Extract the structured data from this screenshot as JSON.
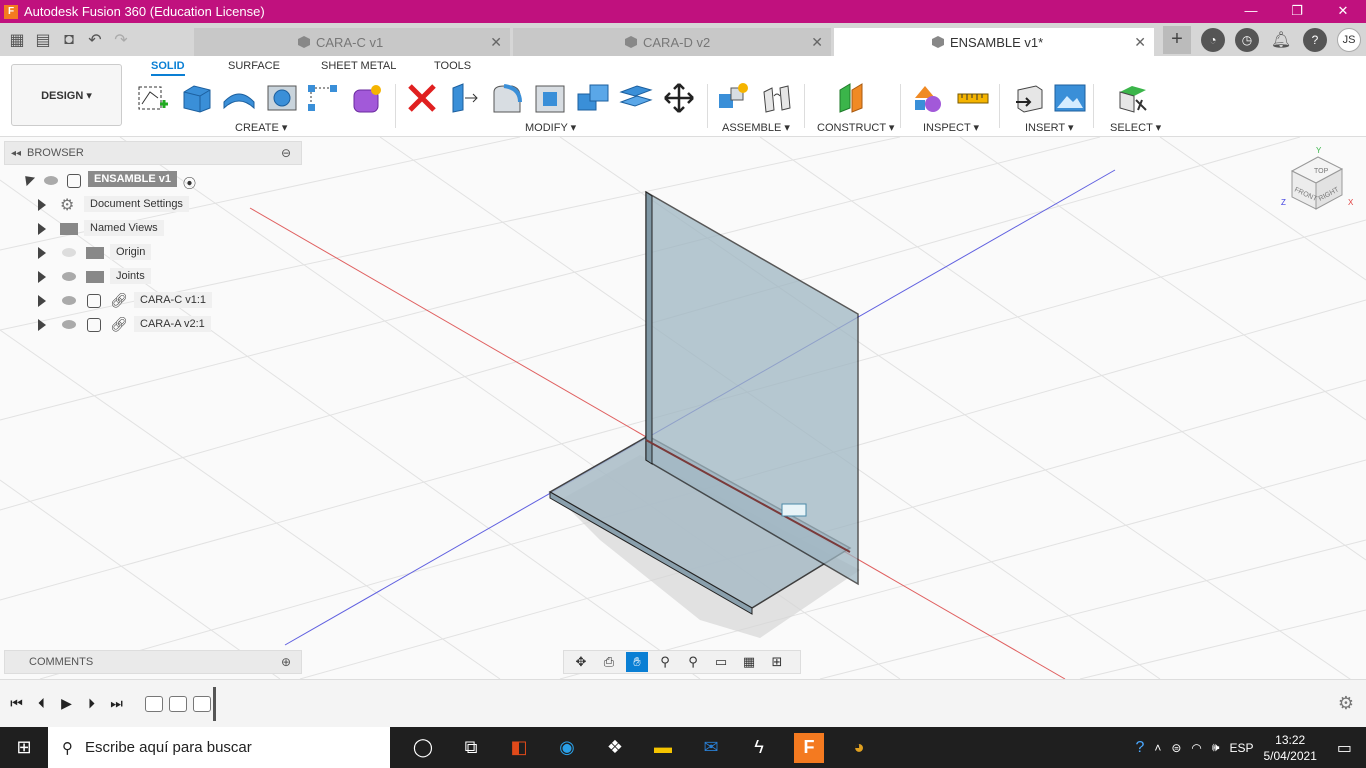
{
  "window": {
    "title": "Autodesk Fusion 360 (Education License)",
    "app_icon_letter": "F"
  },
  "tabs": [
    {
      "label": "CARA-C v1",
      "active": false
    },
    {
      "label": "CARA-D v2",
      "active": false
    },
    {
      "label": "ENSAMBLE v1*",
      "active": true
    }
  ],
  "user_initials": "JS",
  "workspace_button": "DESIGN ▾",
  "ribbon_tabs": [
    "SOLID",
    "SURFACE",
    "SHEET METAL",
    "TOOLS"
  ],
  "ribbon_groups": [
    "CREATE ▾",
    "MODIFY ▾",
    "ASSEMBLE ▾",
    "CONSTRUCT ▾",
    "INSPECT ▾",
    "INSERT ▾",
    "SELECT ▾"
  ],
  "browser": {
    "title": "BROWSER",
    "root": "ENSAMBLE v1",
    "items": [
      "Document Settings",
      "Named Views",
      "Origin",
      "Joints",
      "CARA-C v1:1",
      "CARA-A v2:1"
    ]
  },
  "comments_title": "COMMENTS",
  "viewcube": {
    "top": "TOP",
    "front": "FRONT",
    "right": "RIGHT",
    "axis_x": "X",
    "axis_y": "Y",
    "axis_z": "Z"
  },
  "taskbar": {
    "search_placeholder": "Escribe aquí para buscar",
    "language": "ESP",
    "time": "13:22",
    "date": "5/04/2021"
  },
  "colors": {
    "titlebar": "#c0117e",
    "accent": "#0a7fd4",
    "part_fill": "#9fb6c2"
  }
}
